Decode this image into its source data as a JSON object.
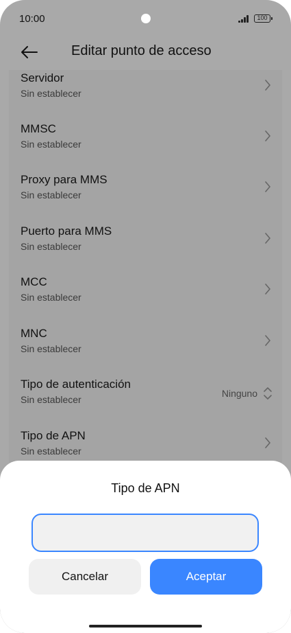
{
  "status_bar": {
    "time": "10:00",
    "battery": "100"
  },
  "header": {
    "title": "Editar punto de acceso",
    "back_icon": "arrow-left-icon"
  },
  "settings": {
    "items": [
      {
        "title": "Servidor",
        "subtitle": "Sin establecer"
      },
      {
        "title": "MMSC",
        "subtitle": "Sin establecer"
      },
      {
        "title": "Proxy para MMS",
        "subtitle": "Sin establecer"
      },
      {
        "title": "Puerto para MMS",
        "subtitle": "Sin establecer"
      },
      {
        "title": "MCC",
        "subtitle": "Sin establecer"
      },
      {
        "title": "MNC",
        "subtitle": "Sin establecer"
      },
      {
        "title": "Tipo de autenticación",
        "subtitle": "Sin establecer",
        "value": "Ninguno"
      },
      {
        "title": "Tipo de APN",
        "subtitle": "Sin establecer"
      }
    ]
  },
  "dialog": {
    "title": "Tipo de APN",
    "input_value": "",
    "cancel_label": "Cancelar",
    "accept_label": "Aceptar",
    "accent_color": "#3a86ff"
  }
}
